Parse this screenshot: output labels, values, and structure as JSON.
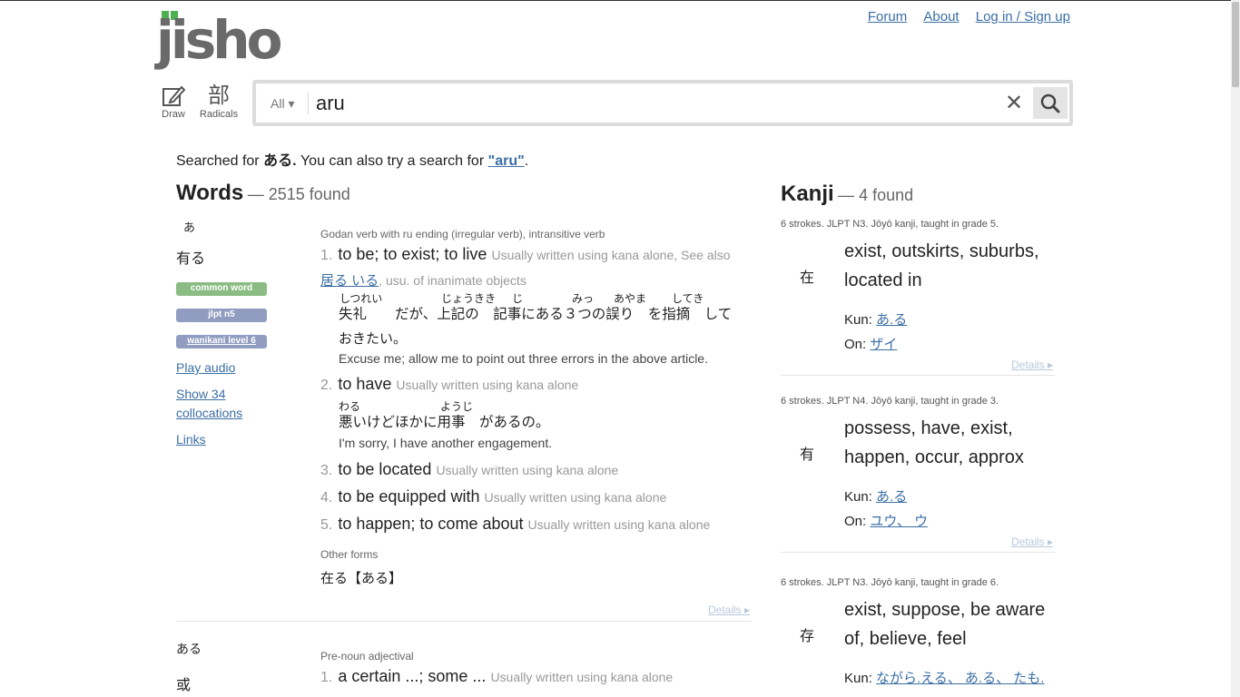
{
  "header": {
    "logo": "jisho",
    "nav": [
      "Forum",
      "About",
      "Log in / Sign up"
    ],
    "tools": {
      "draw": "Draw",
      "radicals_glyph": "部",
      "radicals": "Radicals"
    }
  },
  "search": {
    "scope": "All ▾",
    "value": "aru",
    "clear_glyph": "✕"
  },
  "searched": {
    "prefix": "Searched for",
    "term": "ある.",
    "middle": "You can also try a search for",
    "alt": "\"aru\"",
    "suffix": "."
  },
  "words": {
    "title": "Words",
    "count": "— 2515 found",
    "entries": [
      {
        "furigana": "あ",
        "kanji": "有る",
        "tags": [
          "common word",
          "jlpt n5",
          "wanikani level 6"
        ],
        "links": [
          "Play audio",
          "Show 34 collocations",
          "Links"
        ],
        "pos": "Godan verb with ru ending (irregular verb), intransitive verb",
        "meanings": [
          {
            "num": "1.",
            "text": "to be; to exist; to live",
            "info": "Usually written using kana alone, See also",
            "info_link": "居る いる",
            "info_tail": ", usu. of inanimate objects"
          },
          {
            "num": "2.",
            "text": "to have",
            "info": "Usually written using kana alone"
          },
          {
            "num": "3.",
            "text": "to be located",
            "info": "Usually written using kana alone"
          },
          {
            "num": "4.",
            "text": "to be equipped with",
            "info": "Usually written using kana alone"
          },
          {
            "num": "5.",
            "text": "to happen; to come about",
            "info": "Usually written using kana alone"
          }
        ],
        "sentence1": {
          "line1": "失礼　　だが、上記の　記事にある３つの誤り　を指摘　して",
          "line2": "おきたい。",
          "readings": [
            "しつれい",
            "じょうきき",
            "じ",
            "みっ",
            "あやま",
            "してき"
          ],
          "english": "Excuse me; allow me to point out three errors in the above article."
        },
        "sentence2": {
          "line1": "悪いけどほかに用事　があるの。",
          "readings": [
            "わる",
            "ようじ"
          ],
          "english": "I'm sorry, I have another engagement."
        },
        "other_forms_label": "Other forms",
        "other_forms": "在る【ある】",
        "details": "Details ▸"
      },
      {
        "furigana": "ある",
        "kanji": "或",
        "pos": "Pre-noun adjectival",
        "meanings": [
          {
            "num": "1.",
            "text": "a certain ...; some ...",
            "info": "Usually written using kana alone"
          }
        ]
      }
    ]
  },
  "kanji": {
    "title": "Kanji",
    "count": "— 4 found",
    "kun_label": "Kun:",
    "on_label": "On:",
    "details": "Details ▸",
    "items": [
      {
        "meta": "6 strokes. JLPT N3. Jōyō kanji, taught in grade 5.",
        "char": "在",
        "meaning": "exist, outskirts, suburbs, located in",
        "kun": "あ.る",
        "on": "ザイ"
      },
      {
        "meta": "6 strokes. JLPT N4. Jōyō kanji, taught in grade 3.",
        "char": "有",
        "meaning": "possess, have, exist, happen, occur, approx",
        "kun": "あ.る",
        "on": "ユウ、 ウ"
      },
      {
        "meta": "6 strokes. JLPT N3. Jōyō kanji, taught in grade 6.",
        "char": "存",
        "meaning": "exist, suppose, be aware of, believe, feel",
        "kun": "ながら.える、 あ.る、 たも."
      }
    ]
  },
  "colors": {
    "link": "#3b6ea5",
    "common_tag": "#8abc83",
    "jlpt_tag": "#909dc0",
    "logo_leaf": "#4caf50"
  },
  "icons": [
    "pencil-icon",
    "search-icon",
    "close-icon"
  ]
}
